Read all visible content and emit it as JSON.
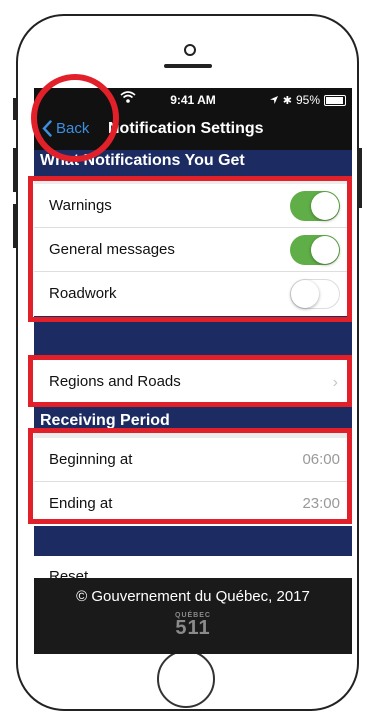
{
  "status_bar": {
    "time": "9:41 AM",
    "battery": "95%",
    "battery_level": 0.95
  },
  "nav": {
    "back_label": "Back",
    "title": "Notification Settings"
  },
  "sections": {
    "notifications_header": "What Notifications You Get",
    "receiving_header": "Receiving Period"
  },
  "notifications": [
    {
      "label": "Warnings",
      "enabled": true
    },
    {
      "label": "General messages",
      "enabled": true
    },
    {
      "label": "Roadwork",
      "enabled": false
    }
  ],
  "regions": {
    "label": "Regions and Roads"
  },
  "period": {
    "beginning_label": "Beginning at",
    "beginning_value": "06:00",
    "ending_label": "Ending at",
    "ending_value": "23:00"
  },
  "reset_label": "Reset",
  "footer": {
    "copyright": "© Gouvernement du Québec, 2017",
    "logo_top": "QUÉBEC",
    "logo_main": "511"
  },
  "colors": {
    "toggle_on": "#5fae47",
    "section_band": "#1c2c63",
    "highlight": "#e2202a",
    "back_link": "#3d8fe0"
  }
}
